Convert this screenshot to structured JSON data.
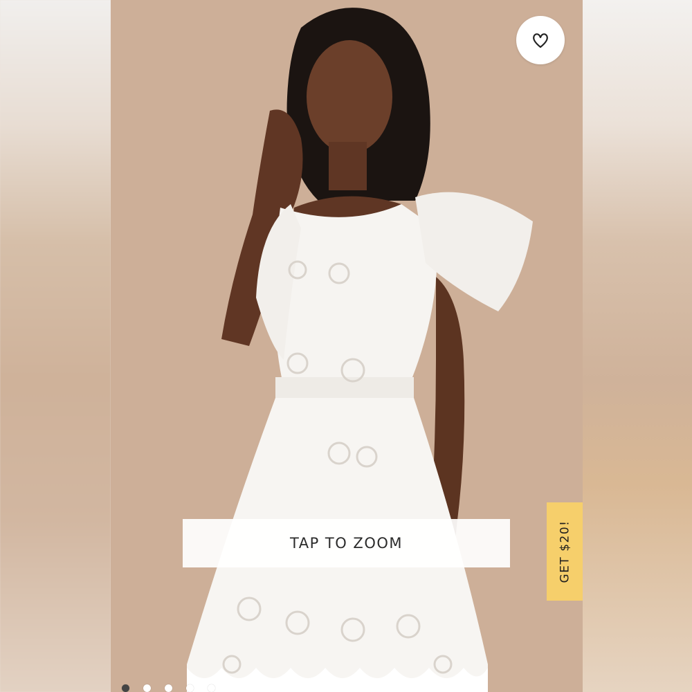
{
  "product_image": {
    "alt_icon": "dress-photo",
    "background_color": "#cdaf98"
  },
  "wishlist": {
    "icon": "heart-icon"
  },
  "zoom": {
    "label": "TAP TO ZOOM"
  },
  "promo": {
    "label": "GET $20!",
    "color": "#f6cf6b"
  },
  "carousel": {
    "total_dots": 5,
    "active_index": 0
  }
}
